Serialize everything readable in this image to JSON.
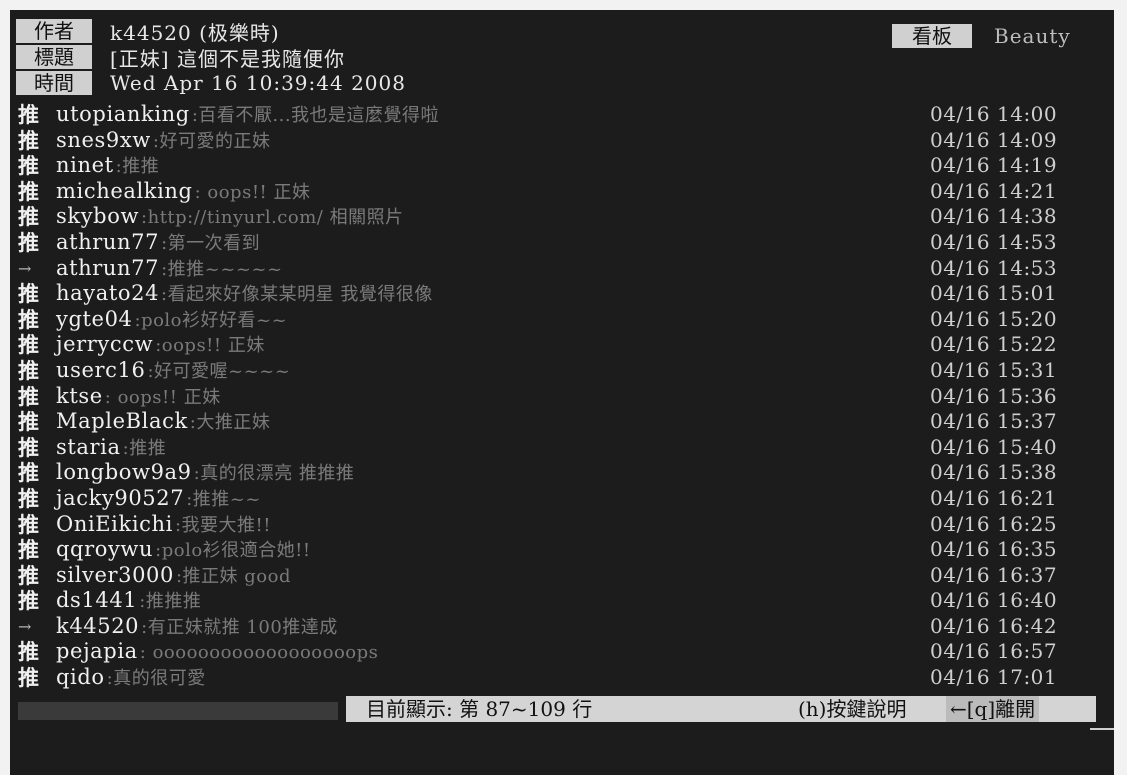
{
  "header": {
    "author_label": "作者",
    "author_value": "k44520 (极樂時)",
    "title_label": "標題",
    "title_value": "[正妹] 這個不是我隨便你",
    "time_label": "時間",
    "time_value": "Wed Apr 16 10:39:44 2008",
    "board_label": "看板",
    "board_value": "Beauty"
  },
  "pushes": [
    {
      "tag": "推",
      "user": "utopianking",
      "content": ":百看不厭...我也是這麼覺得啦",
      "time": "04/16 14:00"
    },
    {
      "tag": "推",
      "user": "snes9xw",
      "content": ":好可愛的正妹",
      "time": "04/16 14:09"
    },
    {
      "tag": "推",
      "user": "ninet",
      "content": ":推推",
      "time": "04/16 14:19"
    },
    {
      "tag": "推",
      "user": "michealking",
      "content": ": oops!! 正妹",
      "time": "04/16 14:21"
    },
    {
      "tag": "推",
      "user": "skybow",
      "content": ":http://tinyurl.com/ 相關照片",
      "time": "04/16 14:38"
    },
    {
      "tag": "推",
      "user": "athrun77",
      "content": ":第一次看到",
      "time": "04/16 14:53"
    },
    {
      "tag": "→",
      "user": "athrun77",
      "content": ":推推~~~~~",
      "time": "04/16 14:53"
    },
    {
      "tag": "推",
      "user": "hayato24",
      "content": ":看起來好像某某明星 我覺得很像",
      "time": "04/16 15:01"
    },
    {
      "tag": "推",
      "user": "ygte04",
      "content": ":polo衫好好看~~",
      "time": "04/16 15:20"
    },
    {
      "tag": "推",
      "user": "jerryccw",
      "content": ":oops!! 正妹",
      "time": "04/16 15:22"
    },
    {
      "tag": "推",
      "user": "userc16",
      "content": ":好可愛喔~~~~",
      "time": "04/16 15:31"
    },
    {
      "tag": "推",
      "user": "ktse",
      "content": ": oops!! 正妹",
      "time": "04/16 15:36"
    },
    {
      "tag": "推",
      "user": "MapleBlack",
      "content": ":大推正妹",
      "time": "04/16 15:37"
    },
    {
      "tag": "推",
      "user": "staria",
      "content": ":推推",
      "time": "04/16 15:40"
    },
    {
      "tag": "推",
      "user": "longbow9a9",
      "content": ":真的很漂亮 推推推",
      "time": "04/16 15:38"
    },
    {
      "tag": "推",
      "user": "jacky90527",
      "content": ":推推~~",
      "time": "04/16 16:21"
    },
    {
      "tag": "推",
      "user": "OniEikichi",
      "content": ":我要大推!!",
      "time": "04/16 16:25"
    },
    {
      "tag": "推",
      "user": "qqroywu",
      "content": ":polo衫很適合她!!",
      "time": "04/16 16:35"
    },
    {
      "tag": "推",
      "user": "silver3000",
      "content": ":推正妹 good",
      "time": "04/16 16:37"
    },
    {
      "tag": "推",
      "user": "ds1441",
      "content": ":推推推",
      "time": "04/16 16:40"
    },
    {
      "tag": "→",
      "user": "k44520",
      "content": ":有正妹就推 100推達成",
      "time": "04/16 16:42"
    },
    {
      "tag": "推",
      "user": "pejapia",
      "content": ": oooooooooooooooooops",
      "time": "04/16 16:57"
    },
    {
      "tag": "推",
      "user": "qido",
      "content": ":真的很可愛",
      "time": "04/16 17:01"
    }
  ],
  "status": {
    "position_text": "目前顯示: 第 87~109 行",
    "help_text": "(h)按鍵說明",
    "exit_text": "←[q]離開"
  }
}
